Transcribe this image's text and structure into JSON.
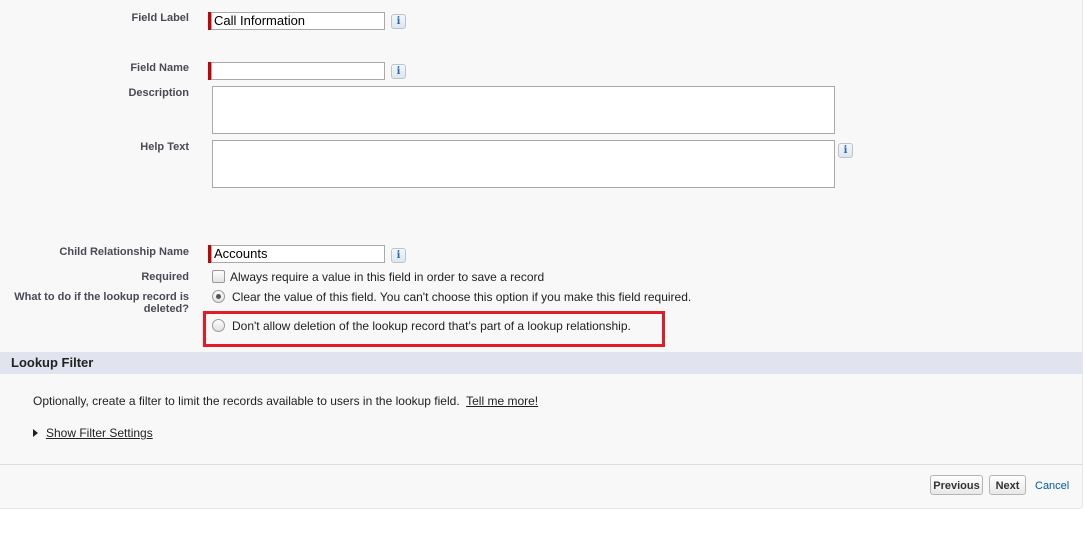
{
  "form": {
    "field_label": {
      "label": "Field Label",
      "value": "Call Information"
    },
    "field_name": {
      "label": "Field Name",
      "value": ""
    },
    "description": {
      "label": "Description",
      "value": ""
    },
    "help_text": {
      "label": "Help Text",
      "value": ""
    },
    "child_relationship_name": {
      "label": "Child Relationship Name",
      "value": "Accounts"
    },
    "required": {
      "label": "Required",
      "checkbox_text": "Always require a value in this field in order to save a record",
      "checked": false
    },
    "on_delete": {
      "label_line1": "What to do if the lookup record is",
      "label_line2": "deleted?",
      "options": [
        {
          "text": "Clear the value of this field. You can't choose this option if you make this field required.",
          "selected": true
        },
        {
          "text": "Don't allow deletion of the lookup record that's part of a lookup relationship.",
          "selected": false
        }
      ]
    },
    "info_icon_glyph": "i"
  },
  "lookup_filter": {
    "title": "Lookup Filter",
    "description": "Optionally, create a filter to limit the records available to users in the lookup field.",
    "tell_me_more": "Tell me more!",
    "show_filter_settings": "Show Filter Settings"
  },
  "footer": {
    "previous": "Previous",
    "next": "Next",
    "cancel": "Cancel"
  },
  "colors": {
    "required_bar": "#cc0000",
    "highlight_box": "#e01d22",
    "section_header_bg": "#e1e4ee",
    "cancel_link": "#015ba7"
  }
}
